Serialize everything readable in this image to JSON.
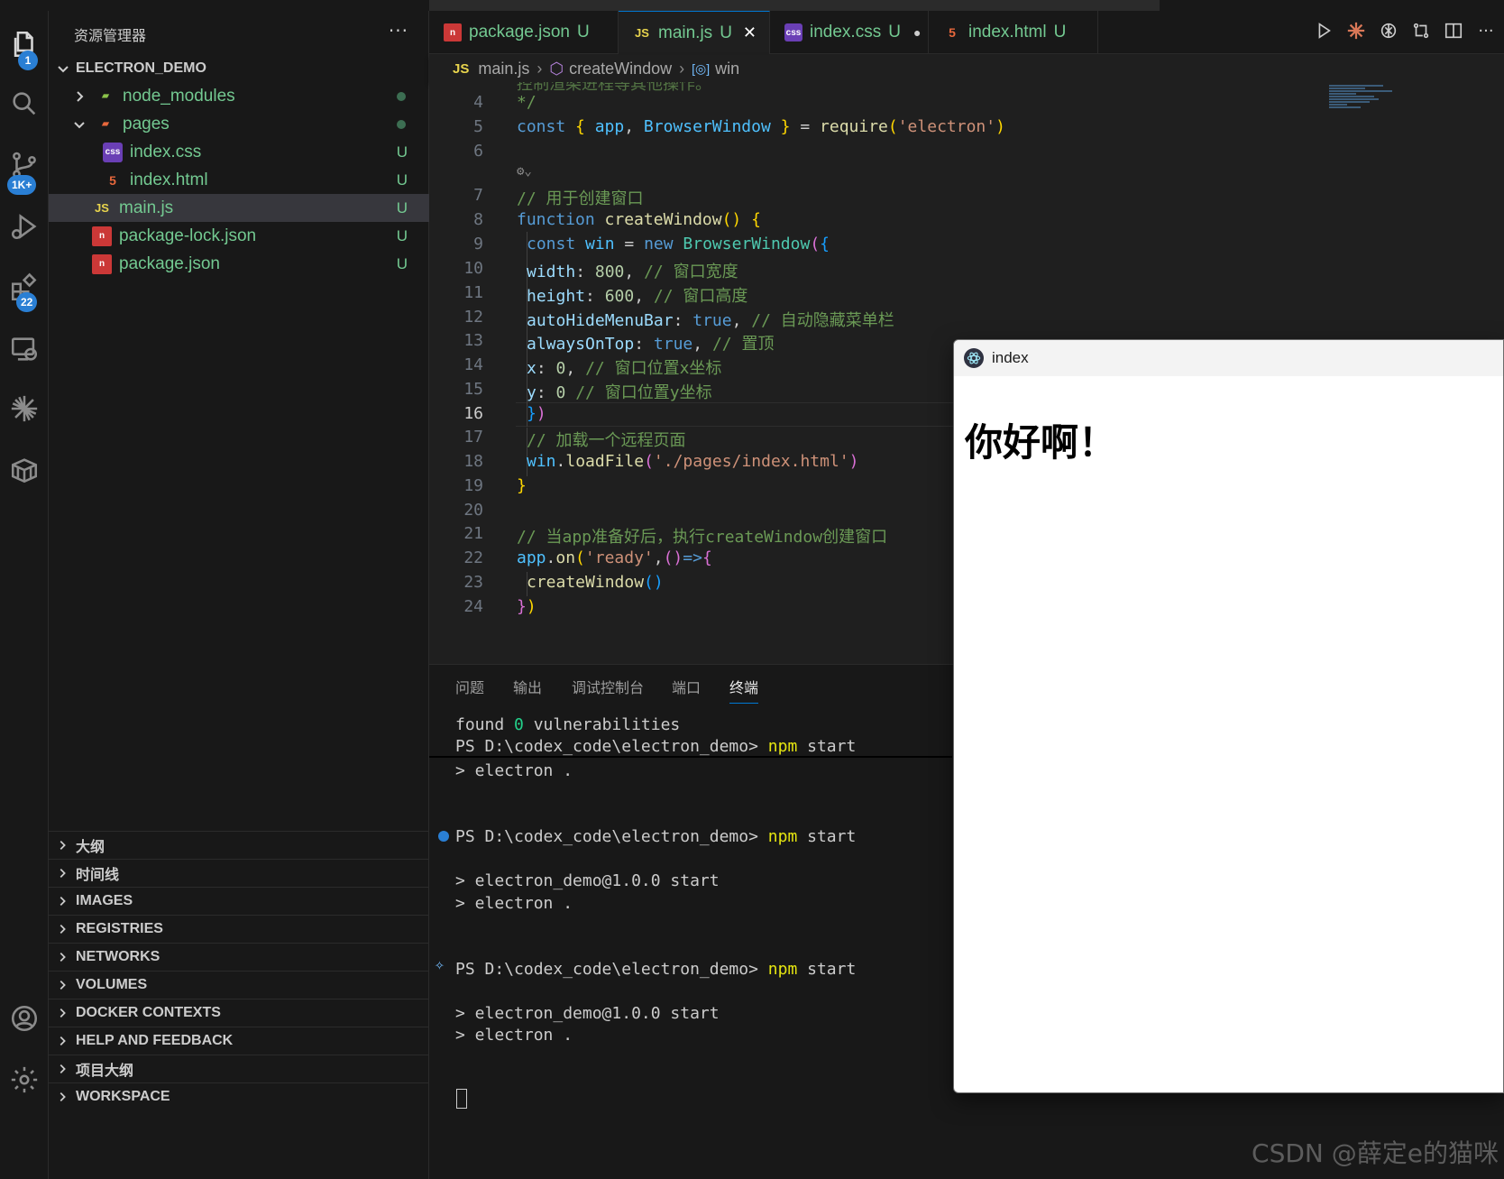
{
  "sidebar": {
    "title": "资源管理器",
    "more": "···",
    "root": "ELECTRON_DEMO",
    "tree": [
      {
        "name": "node_modules",
        "status": ""
      },
      {
        "name": "pages",
        "status": ""
      },
      {
        "name": "index.css",
        "status": "U"
      },
      {
        "name": "index.html",
        "status": "U"
      },
      {
        "name": "main.js",
        "status": "U"
      },
      {
        "name": "package-lock.json",
        "status": "U"
      },
      {
        "name": "package.json",
        "status": "U"
      }
    ],
    "panels": [
      "大纲",
      "时间线",
      "IMAGES",
      "REGISTRIES",
      "NETWORKS",
      "VOLUMES",
      "DOCKER CONTEXTS",
      "HELP AND FEEDBACK",
      "项目大纲",
      "WORKSPACE"
    ]
  },
  "activity": {
    "explorer_badge": "1",
    "scm_badge": "1K+",
    "extensions_badge": "22"
  },
  "tabs": [
    {
      "label": "package.json",
      "status": "U",
      "icon": "JSON"
    },
    {
      "label": "main.js",
      "status": "U",
      "icon": "JS",
      "close": "✕"
    },
    {
      "label": "index.css",
      "status": "U",
      "icon": "css",
      "dirty": "●"
    },
    {
      "label": "index.html",
      "status": "U",
      "icon": "5"
    }
  ],
  "breadcrumb": {
    "file_icon": "JS",
    "file": "main.js",
    "fn": "createWindow",
    "var_icon": "[◎]",
    "var": "win"
  },
  "editor": {
    "partial_line": "控制渲染进程等其他操作。",
    "lines": [
      {
        "n": "4",
        "text": "*/"
      },
      {
        "n": "5",
        "text": "const { app, BrowserWindow } = require('electron')"
      },
      {
        "n": "6",
        "text": ""
      },
      {
        "n": "7",
        "text": "// 用于创建窗口"
      },
      {
        "n": "8",
        "text": "function createWindow() {"
      },
      {
        "n": "9",
        "text": "const win = new BrowserWindow({"
      },
      {
        "n": "10",
        "text": "width: 800, // 窗口宽度"
      },
      {
        "n": "11",
        "text": "height: 600, // 窗口高度"
      },
      {
        "n": "12",
        "text": "autoHideMenuBar: true, // 自动隐藏菜单栏"
      },
      {
        "n": "13",
        "text": "alwaysOnTop: true, // 置顶"
      },
      {
        "n": "14",
        "text": "x: 0, // 窗口位置x坐标"
      },
      {
        "n": "15",
        "text": "y: 0 // 窗口位置y坐标"
      },
      {
        "n": "16",
        "text": "})"
      },
      {
        "n": "17",
        "text": "// 加载一个远程页面"
      },
      {
        "n": "18",
        "text": "win.loadFile('./pages/index.html')"
      },
      {
        "n": "19",
        "text": "}"
      },
      {
        "n": "20",
        "text": ""
      },
      {
        "n": "21",
        "text": "// 当app准备好后，执行createWindow创建窗口"
      },
      {
        "n": "22",
        "text": "app.on('ready',()=>{"
      },
      {
        "n": "23",
        "text": "createWindow()"
      },
      {
        "n": "24",
        "text": "})"
      }
    ]
  },
  "panel": {
    "tabs": [
      "问题",
      "输出",
      "调试控制台",
      "端口",
      "终端"
    ],
    "active_tab": "终端",
    "terminal": {
      "found": "found ",
      "found_count": "0",
      "vulnerabilities": " vulnerabilities",
      "prompt": "PS D:\\codex_code\\electron_demo> ",
      "npm": "npm",
      "start": " start",
      "electron_cmd": "> electron .",
      "start_line": "> electron_demo@1.0.0 start"
    }
  },
  "electron_window": {
    "title": "index",
    "heading": "你好啊！"
  },
  "watermark": "CSDN @薛定e的猫咪"
}
